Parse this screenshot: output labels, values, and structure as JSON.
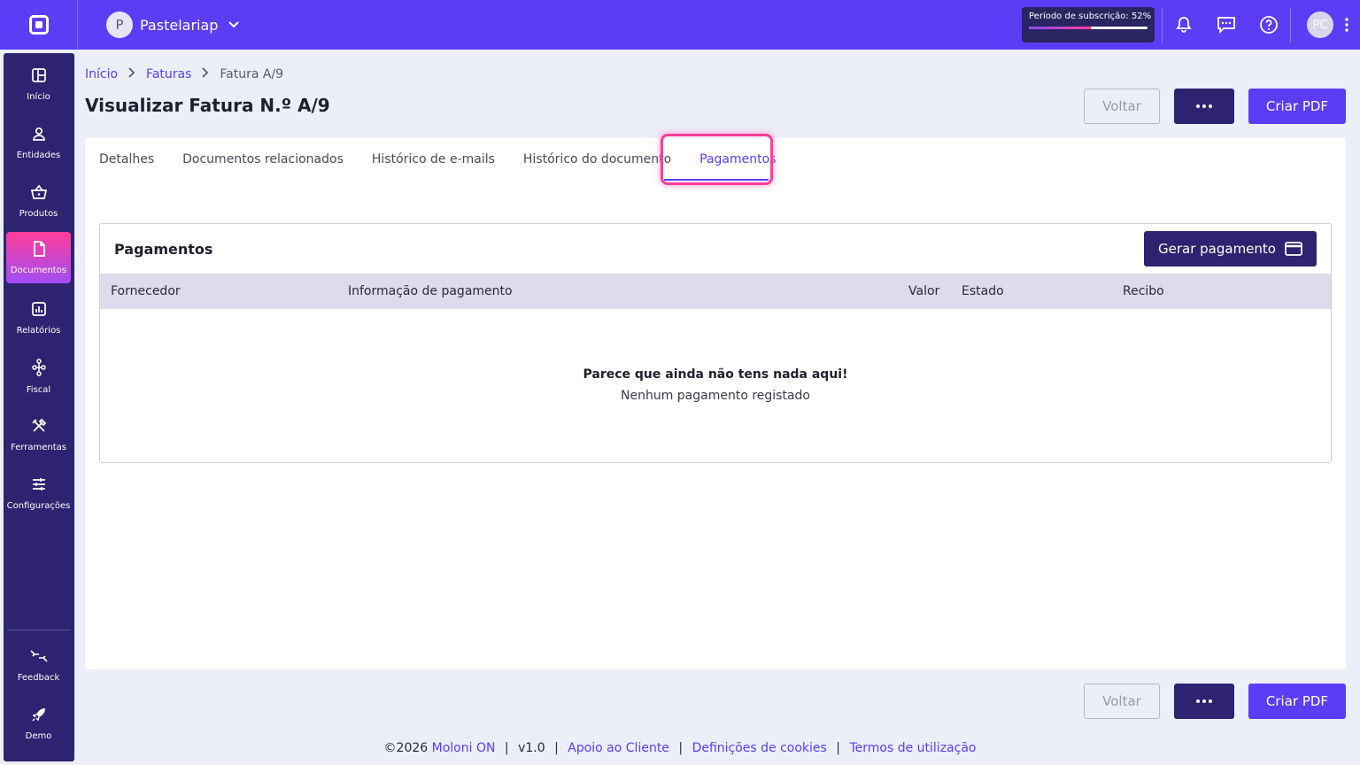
{
  "app": {
    "logo": "moloni-logo-icon",
    "company_initial": "P",
    "company_name": "Pastelariap",
    "subscription_text": "Período de subscrição: 52%",
    "subscription_progress": 0.52,
    "user_initials": "PC"
  },
  "sidebar": {
    "items": [
      {
        "label": "Início",
        "icon": "dashboard-icon"
      },
      {
        "label": "Entidades",
        "icon": "person-icon"
      },
      {
        "label": "Produtos",
        "icon": "basket-icon"
      },
      {
        "label": "Documentos",
        "icon": "document-icon",
        "active": true
      },
      {
        "label": "Relatórios",
        "icon": "chart-icon"
      },
      {
        "label": "Fiscal",
        "icon": "hierarchy-icon"
      },
      {
        "label": "Ferramentas",
        "icon": "tools-icon"
      },
      {
        "label": "Configurações",
        "icon": "sliders-icon"
      }
    ],
    "bottom": [
      {
        "label": "Feedback",
        "icon": "feedback-icon"
      },
      {
        "label": "Demo",
        "icon": "rocket-icon"
      }
    ]
  },
  "breadcrumb": {
    "home": "Início",
    "section": "Faturas",
    "current": "Fatura A/9"
  },
  "page": {
    "title": "Visualizar Fatura N.º A/9"
  },
  "actions": {
    "back": "Voltar",
    "create_pdf": "Criar PDF"
  },
  "tabs": [
    "Detalhes",
    "Documentos relacionados",
    "Histórico de e-mails",
    "Histórico do documento",
    "Pagamentos"
  ],
  "payments": {
    "title": "Pagamentos",
    "generate_button": "Gerar pagamento",
    "columns": {
      "supplier": "Fornecedor",
      "payment_info": "Informação de pagamento",
      "value": "Valor",
      "status": "Estado",
      "receipt": "Recibo"
    },
    "empty_title": "Parece que ainda não tens nada aqui!",
    "empty_subtitle": "Nenhum pagamento registado"
  },
  "footer": {
    "copyright": "©2026",
    "brand": "Moloni ON",
    "version": "v1.0",
    "support": "Apoio ao Cliente",
    "cookies": "Definições de cookies",
    "terms": "Termos de utilização"
  },
  "colors": {
    "primary": "#5b3df5",
    "dark": "#2d2370",
    "highlight": "#ff3d9a"
  }
}
